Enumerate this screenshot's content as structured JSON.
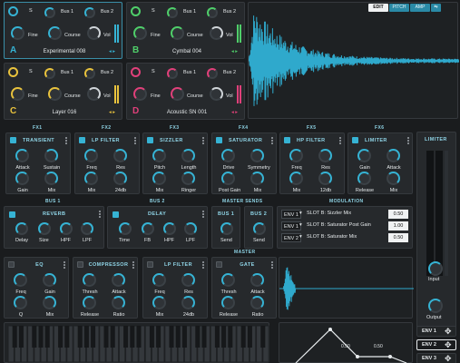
{
  "header_tabs": [
    "EDIT",
    "PITCH",
    "AMP"
  ],
  "refresh_icon": "refresh-icon",
  "slots": [
    {
      "letter": "A",
      "name": "Experimental 008",
      "bus1": "Bus 1",
      "bus2": "Bus 2",
      "s": "S",
      "fine": "Fine",
      "course": "Course",
      "vol": "Vol",
      "color": "#36b3d4"
    },
    {
      "letter": "B",
      "name": "Cymbal 004",
      "bus1": "Bus 1",
      "bus2": "Bus 2",
      "s": "S",
      "fine": "Fine",
      "course": "Course",
      "vol": "Vol",
      "color": "#4fcf6a"
    },
    {
      "letter": "C",
      "name": "Layer 016",
      "bus1": "Bus 1",
      "bus2": "Bus 2",
      "s": "S",
      "fine": "Fine",
      "course": "Course",
      "vol": "Vol",
      "color": "#e8c23d"
    },
    {
      "letter": "D",
      "name": "Acoustic SN 001",
      "bus1": "Bus 1",
      "bus2": "Bus 2",
      "s": "S",
      "fine": "Fine",
      "course": "Course",
      "vol": "Vol",
      "color": "#e0407a"
    }
  ],
  "fx_sections": [
    "FX1",
    "FX2",
    "FX3",
    "FX4",
    "FX5",
    "FX6"
  ],
  "fx": [
    {
      "title": "TRANSIENT",
      "k": [
        "Attack",
        "Sustain",
        "Gain",
        "Mix"
      ]
    },
    {
      "title": "LP FILTER",
      "k": [
        "Freq",
        "Res",
        "Mix",
        "24db"
      ]
    },
    {
      "title": "SIZZLER",
      "k": [
        "Pitch",
        "Length",
        "Mix",
        "Ringer"
      ]
    },
    {
      "title": "SATURATOR",
      "k": [
        "Drive",
        "Symmetry",
        "Post Gain",
        "Mix"
      ]
    },
    {
      "title": "HP FILTER",
      "k": [
        "Freq",
        "Res",
        "Mix",
        "12db"
      ]
    },
    {
      "title": "LIMITER",
      "k": [
        "Gain",
        "Attack",
        "Release",
        "Mix"
      ]
    }
  ],
  "limiter": {
    "title": "LIMITER",
    "input": "Input",
    "output": "Output"
  },
  "bus_sections": [
    "BUS 1",
    "BUS 2",
    "MASTER SENDS",
    "MODULATION"
  ],
  "reverb": {
    "title": "REVERB",
    "k": [
      "Delay",
      "Size",
      "HPF",
      "LPF"
    ]
  },
  "delay": {
    "title": "DELAY",
    "k": [
      "Time",
      "FB",
      "HPF",
      "LPF"
    ]
  },
  "sends": [
    {
      "title": "BUS 1",
      "k": "Send"
    },
    {
      "title": "BUS 2",
      "k": "Send"
    }
  ],
  "modulation": [
    {
      "env": "ENV 1",
      "target": "SLOT B: Sizzler Mix",
      "value": "0.50"
    },
    {
      "env": "ENV 1",
      "target": "SLOT B: Saturator Post Gain",
      "value": "1.00"
    },
    {
      "env": "ENV 2",
      "target": "SLOT B: Saturator Mix",
      "value": "0.50"
    }
  ],
  "master_label": "MASTER",
  "eq": {
    "title": "EQ",
    "k": [
      "Freq",
      "Gain",
      "Q",
      "Mix"
    ]
  },
  "compressor": {
    "title": "COMPRESSOR",
    "k": [
      "Thresh",
      "Attack",
      "Release",
      "Ratio"
    ]
  },
  "mlp": {
    "title": "LP FILTER",
    "k": [
      "Freq",
      "Res",
      "Mix",
      "24db"
    ]
  },
  "gate": {
    "title": "GATE",
    "k": [
      "Thresh",
      "Attack",
      "Release",
      "Ratio"
    ]
  },
  "env_points": [
    "0.50",
    "0.50"
  ],
  "env_buttons": [
    "ENV 1",
    "ENV 2",
    "ENV 3"
  ]
}
